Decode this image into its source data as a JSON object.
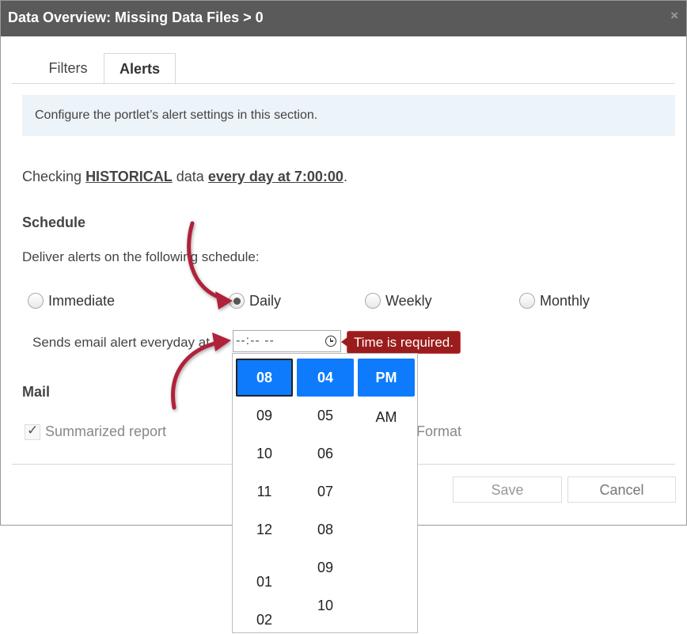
{
  "dialog": {
    "title": "Data Overview: Missing Data Files > 0",
    "close_glyph": "×"
  },
  "tabs": [
    {
      "label": "Filters"
    },
    {
      "label": "Alerts",
      "active": true
    }
  ],
  "info_text": "Configure the portlet’s alert settings in this section.",
  "summary": {
    "prefix": "Checking",
    "data_type": "HISTORICAL",
    "middle": "data",
    "schedule": "every day at 7:00:00",
    "suffix": "."
  },
  "schedule": {
    "heading": "Schedule",
    "deliver_text": "Deliver alerts on the following schedule:",
    "options": [
      {
        "label": "Immediate",
        "checked": false
      },
      {
        "label": "Daily",
        "checked": true
      },
      {
        "label": "Weekly",
        "checked": false
      },
      {
        "label": "Monthly",
        "checked": false
      }
    ],
    "sends_text": "Sends email alert everyday at",
    "time_value": "--:-- --",
    "error": "Time is required."
  },
  "mail": {
    "heading": "Mail",
    "summarized_label": "Summarized report",
    "summarized_checked": true,
    "format_label": "Format"
  },
  "buttons": {
    "save": "Save",
    "cancel": "Cancel"
  },
  "time_picker": {
    "hours": [
      "08",
      "09",
      "10",
      "11",
      "12",
      "01",
      "02"
    ],
    "minutes": [
      "04",
      "05",
      "06",
      "07",
      "08",
      "09",
      "10"
    ],
    "meridiem": [
      "PM",
      "AM"
    ],
    "selected": {
      "hour": "08",
      "minute": "04",
      "meridiem": "PM"
    }
  },
  "colors": {
    "titlebar": "#5a5a5a",
    "accent": "#0d7bfc",
    "error": "#9b1c1c",
    "arrow": "#b0243a"
  }
}
